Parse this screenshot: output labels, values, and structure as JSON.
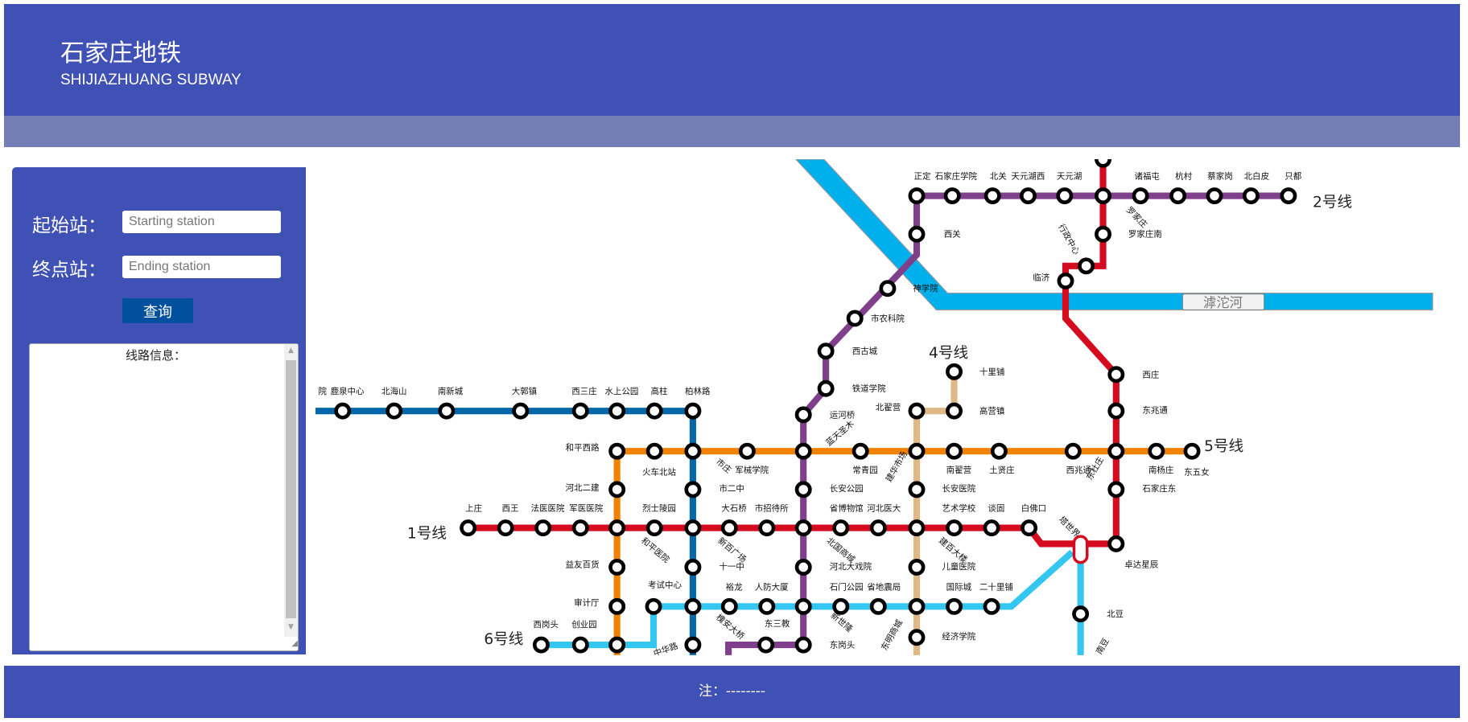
{
  "header": {
    "title": "石家庄地铁",
    "subtitle": "SHIJIAZHUANG SUBWAY"
  },
  "panel": {
    "start_label": "起始站：",
    "start_placeholder": "Starting station",
    "end_label": "终点站：",
    "end_placeholder": "Ending station",
    "query_button": "查询",
    "route_info": "线路信息："
  },
  "map": {
    "river": "滹沱河",
    "line_colors": {
      "line1": "#d50b1f",
      "line2": "#7f3f8a",
      "line3": "#0468a8",
      "line4": "#e0b886",
      "line5": "#f08200",
      "line6": "#33c6f0",
      "river": "#00b0ec"
    },
    "line_labels": [
      "1号线",
      "2号线",
      "4号线",
      "5号线",
      "6号线"
    ],
    "stations": [
      "正定",
      "石家庄学院",
      "北关",
      "天元湖西",
      "天元湖",
      "诸福屯",
      "杭村",
      "蔡家岗",
      "北白皮",
      "只都",
      "西关",
      "罗家庄",
      "罗家庄南",
      "行政中心",
      "临济",
      "神学院",
      "市农科院",
      "西古城",
      "铁道学院",
      "运河桥",
      "北翟营",
      "十里铺",
      "高营镇",
      "西庄",
      "东兆通",
      "石家庄东",
      "卓达星辰",
      "北豆",
      "南豆",
      "塔世界",
      "和平西路",
      "火车北站",
      "市庄",
      "军械学院",
      "蓝天圣木",
      "常青园",
      "建华市场",
      "南翟营",
      "土贤庄",
      "西兆通",
      "东杜庄",
      "南杨庄",
      "东五女",
      "河北二建",
      "益友百货",
      "审计厅",
      "院",
      "鹿泉中心",
      "北海山",
      "南新城",
      "大郭镇",
      "西三庄",
      "水上公园",
      "高柱",
      "柏林路",
      "市二中",
      "十一中",
      "新百广场",
      "槐安大桥",
      "中华路",
      "上庄",
      "西王",
      "法医医院",
      "军医医院",
      "烈士陵园",
      "大石桥",
      "市招待所",
      "省博物馆",
      "河北医大",
      "艺术学校",
      "谈固",
      "白佛口",
      "和平医院",
      "北国商城",
      "建百大楼",
      "长安公园",
      "长安医院",
      "河北大戏院",
      "儿童医院",
      "考试中心",
      "裕龙",
      "人防大厦",
      "石门公园",
      "省地震局",
      "国际城",
      "二十里铺",
      "西岗头",
      "创业园",
      "东三教",
      "新世隆",
      "东明商城",
      "经济学院",
      "东岗头"
    ]
  },
  "footer": {
    "note": "注：--------"
  }
}
